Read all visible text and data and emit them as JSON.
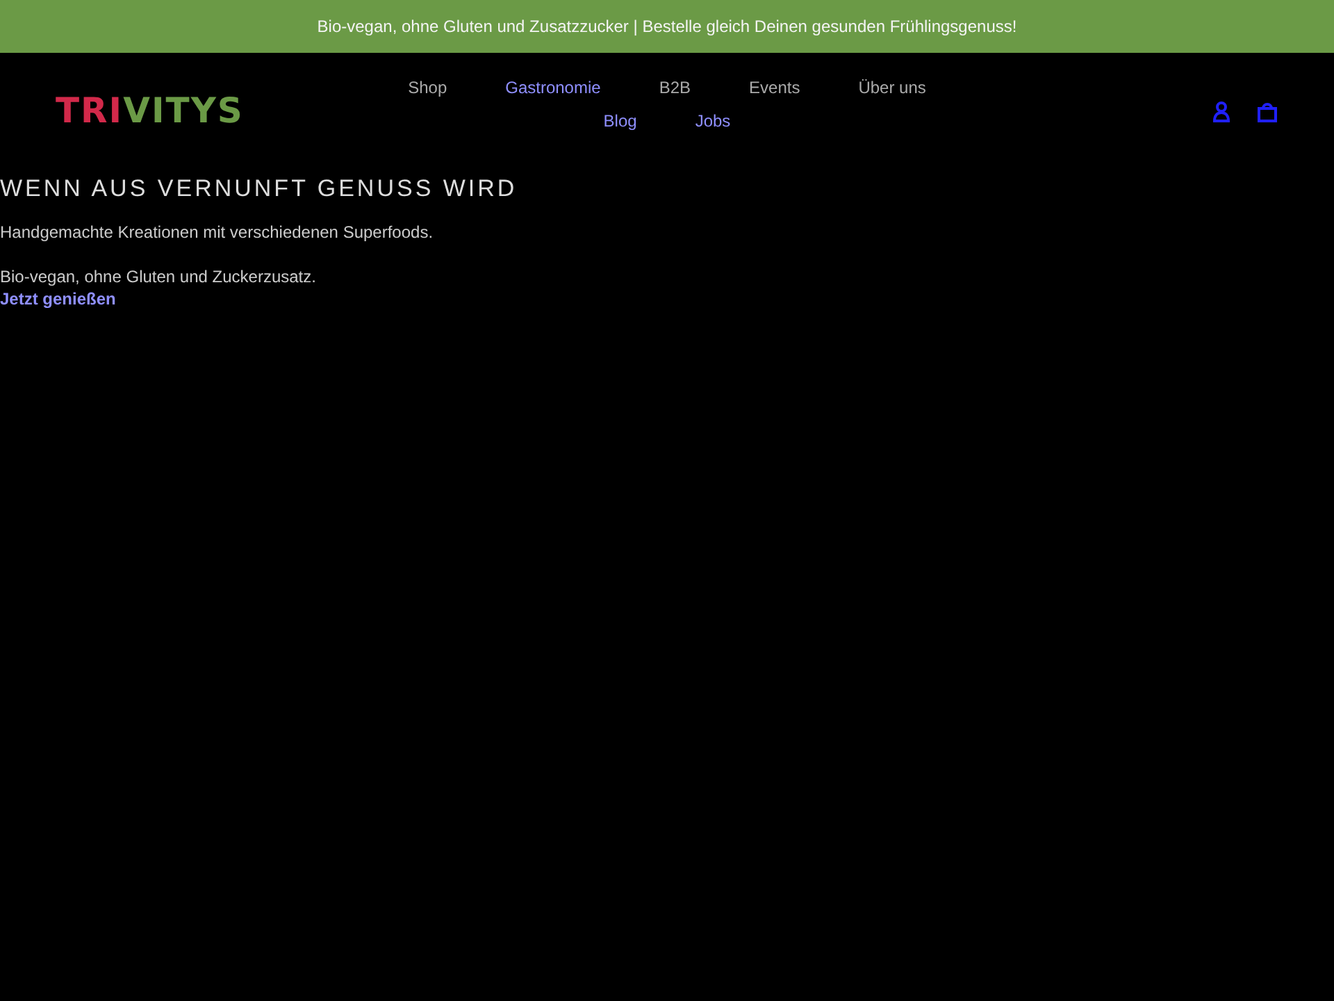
{
  "announcement": "Bio-vegan, ohne Gluten und Zusatzzucker | Bestelle gleich Deinen gesunden Frühlingsgenuss!",
  "logo": {
    "part_1": "TRI",
    "part_2": "VITYS"
  },
  "nav": [
    {
      "label": "Shop",
      "visited": false
    },
    {
      "label": "Gastronomie",
      "visited": true
    },
    {
      "label": "B2B",
      "visited": false
    },
    {
      "label": "Events",
      "visited": false
    },
    {
      "label": "Über uns",
      "visited": false
    },
    {
      "label": "Blog",
      "visited": true
    },
    {
      "label": "Jobs",
      "visited": true
    }
  ],
  "hero": {
    "headline": "WENN AUS VERNUNFT GENUSS WIRD",
    "text_1": "Handgemachte Kreationen mit verschiedenen Superfoods.",
    "text_2": "Bio-vegan, ohne Gluten und Zuckerzusatz.",
    "link": "Jetzt genießen"
  }
}
